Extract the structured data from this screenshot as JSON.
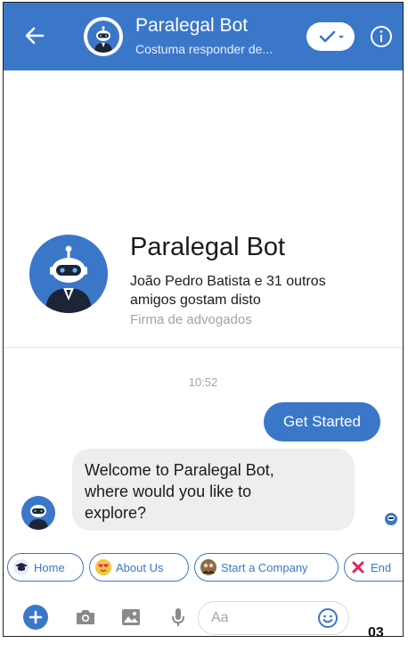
{
  "header": {
    "title": "Paralegal Bot",
    "subtitle": "Costuma responder de...",
    "back_icon": "arrow-left-icon",
    "check_icon": "check-dropdown-icon",
    "info_icon": "info-icon"
  },
  "profile": {
    "name": "Paralegal Bot",
    "likes": "João Pedro Batista e 31 outros amigos gostam disto",
    "category": "Firma de advogados"
  },
  "chat": {
    "timestamp": "10:52",
    "user_message": "Get Started",
    "bot_message_lines": [
      "Welcome to Paralegal Bot,",
      "where would you like to",
      "explore?"
    ]
  },
  "quick_replies": [
    {
      "label": "Home",
      "icon": "graduation-cap-icon"
    },
    {
      "label": "About Us",
      "icon": "heart-eyes-emoji-icon"
    },
    {
      "label": "Start a Company",
      "icon": "people-icon"
    },
    {
      "label": "End",
      "icon": "cross-mark-icon"
    }
  ],
  "composer": {
    "placeholder": "Aa"
  },
  "figure_label": "03",
  "colors": {
    "brand_blue": "#3b77c9",
    "bubble_gray": "#eeeeee",
    "muted_text": "#a3a3a3"
  }
}
